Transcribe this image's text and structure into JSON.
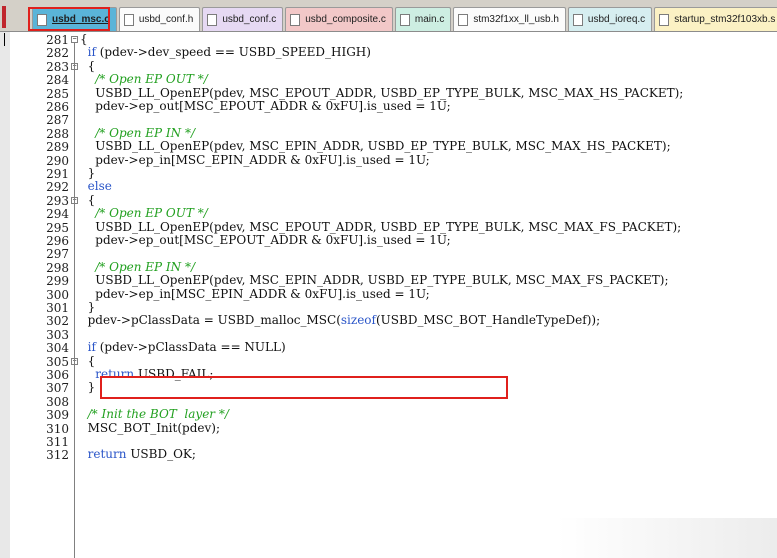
{
  "tabs": [
    {
      "label": "usbd_msc.c",
      "color": "#5ab4d8",
      "active": true
    },
    {
      "label": "usbd_conf.h",
      "color": "#fbfbfb"
    },
    {
      "label": "usbd_conf.c",
      "color": "#e6d9f3"
    },
    {
      "label": "usbd_composite.c",
      "color": "#f2c8c8"
    },
    {
      "label": "main.c",
      "color": "#cdeee2"
    },
    {
      "label": "stm32f1xx_ll_usb.h",
      "color": "#fbfbfb"
    },
    {
      "label": "usbd_ioreq.c",
      "color": "#d6eef0"
    },
    {
      "label": "startup_stm32f103xb.s",
      "color": "#fbf1c4"
    }
  ],
  "code": {
    "lines": [
      {
        "n": "281",
        "fold": "minus",
        "segs": [
          {
            "t": "{",
            "c": ""
          }
        ]
      },
      {
        "n": "282",
        "segs": [
          {
            "t": "  ",
            "c": ""
          },
          {
            "t": "if",
            "c": "kw"
          },
          {
            "t": " (pdev->dev_speed == USBD_SPEED_HIGH)",
            "c": ""
          }
        ]
      },
      {
        "n": "283",
        "fold": "minus",
        "segs": [
          {
            "t": "  {",
            "c": ""
          }
        ]
      },
      {
        "n": "284",
        "segs": [
          {
            "t": "    ",
            "c": ""
          },
          {
            "t": "/* Open EP OUT */",
            "c": "cm"
          }
        ]
      },
      {
        "n": "285",
        "segs": [
          {
            "t": "    USBD_LL_OpenEP(pdev, MSC_EPOUT_ADDR, USBD_EP_TYPE_BULK, MSC_MAX_HS_PACKET);",
            "c": ""
          }
        ]
      },
      {
        "n": "286",
        "segs": [
          {
            "t": "    pdev->ep_out[MSC_EPOUT_ADDR & 0xFU].is_used = 1U;",
            "c": ""
          }
        ]
      },
      {
        "n": "287",
        "segs": [
          {
            "t": "",
            "c": ""
          }
        ]
      },
      {
        "n": "288",
        "segs": [
          {
            "t": "    ",
            "c": ""
          },
          {
            "t": "/* Open EP IN */",
            "c": "cm"
          }
        ]
      },
      {
        "n": "289",
        "segs": [
          {
            "t": "    USBD_LL_OpenEP(pdev, MSC_EPIN_ADDR, USBD_EP_TYPE_BULK, MSC_MAX_HS_PACKET);",
            "c": ""
          }
        ]
      },
      {
        "n": "290",
        "segs": [
          {
            "t": "    pdev->ep_in[MSC_EPIN_ADDR & 0xFU].is_used = 1U;",
            "c": ""
          }
        ]
      },
      {
        "n": "291",
        "segs": [
          {
            "t": "  }",
            "c": ""
          }
        ]
      },
      {
        "n": "292",
        "segs": [
          {
            "t": "  ",
            "c": ""
          },
          {
            "t": "else",
            "c": "kw"
          }
        ]
      },
      {
        "n": "293",
        "fold": "minus",
        "segs": [
          {
            "t": "  {",
            "c": ""
          }
        ]
      },
      {
        "n": "294",
        "segs": [
          {
            "t": "    ",
            "c": ""
          },
          {
            "t": "/* Open EP OUT */",
            "c": "cm"
          }
        ]
      },
      {
        "n": "295",
        "segs": [
          {
            "t": "    USBD_LL_OpenEP(pdev, MSC_EPOUT_ADDR, USBD_EP_TYPE_BULK, MSC_MAX_FS_PACKET);",
            "c": ""
          }
        ]
      },
      {
        "n": "296",
        "segs": [
          {
            "t": "    pdev->ep_out[MSC_EPOUT_ADDR & 0xFU].is_used = 1U;",
            "c": ""
          }
        ]
      },
      {
        "n": "297",
        "segs": [
          {
            "t": "",
            "c": ""
          }
        ]
      },
      {
        "n": "298",
        "segs": [
          {
            "t": "    ",
            "c": ""
          },
          {
            "t": "/* Open EP IN */",
            "c": "cm"
          }
        ]
      },
      {
        "n": "299",
        "segs": [
          {
            "t": "    USBD_LL_OpenEP(pdev, MSC_EPIN_ADDR, USBD_EP_TYPE_BULK, MSC_MAX_FS_PACKET);",
            "c": ""
          }
        ]
      },
      {
        "n": "300",
        "segs": [
          {
            "t": "    pdev->ep_in[MSC_EPIN_ADDR & 0xFU].is_used = 1U;",
            "c": ""
          }
        ]
      },
      {
        "n": "301",
        "segs": [
          {
            "t": "  }",
            "c": ""
          }
        ]
      },
      {
        "n": "302",
        "segs": [
          {
            "t": "  pdev->pClassData = USBD_malloc_MSC(",
            "c": ""
          },
          {
            "t": "sizeof",
            "c": "kw"
          },
          {
            "t": "(USBD_MSC_BOT_HandleTypeDef));",
            "c": ""
          }
        ]
      },
      {
        "n": "303",
        "segs": [
          {
            "t": "",
            "c": ""
          }
        ]
      },
      {
        "n": "304",
        "segs": [
          {
            "t": "  ",
            "c": ""
          },
          {
            "t": "if",
            "c": "kw"
          },
          {
            "t": " (pdev->pClassData == NULL)",
            "c": ""
          }
        ]
      },
      {
        "n": "305",
        "fold": "minus",
        "segs": [
          {
            "t": "  {",
            "c": ""
          }
        ]
      },
      {
        "n": "306",
        "segs": [
          {
            "t": "    ",
            "c": ""
          },
          {
            "t": "return",
            "c": "kw"
          },
          {
            "t": " USBD_FAIL;",
            "c": ""
          }
        ]
      },
      {
        "n": "307",
        "segs": [
          {
            "t": "  }",
            "c": ""
          }
        ]
      },
      {
        "n": "308",
        "segs": [
          {
            "t": "",
            "c": ""
          }
        ]
      },
      {
        "n": "309",
        "segs": [
          {
            "t": "  ",
            "c": ""
          },
          {
            "t": "/* Init the BOT  layer */",
            "c": "cm"
          }
        ]
      },
      {
        "n": "310",
        "segs": [
          {
            "t": "  MSC_BOT_Init(pdev);",
            "c": ""
          }
        ]
      },
      {
        "n": "311",
        "segs": [
          {
            "t": "",
            "c": ""
          }
        ]
      },
      {
        "n": "312",
        "segs": [
          {
            "t": "  ",
            "c": ""
          },
          {
            "t": "return",
            "c": "kw"
          },
          {
            "t": " USBD_OK;",
            "c": ""
          }
        ]
      }
    ]
  },
  "colors": {
    "keyword": "#2a55c8",
    "comment": "#22a020",
    "annotation_box": "#e0201c"
  }
}
